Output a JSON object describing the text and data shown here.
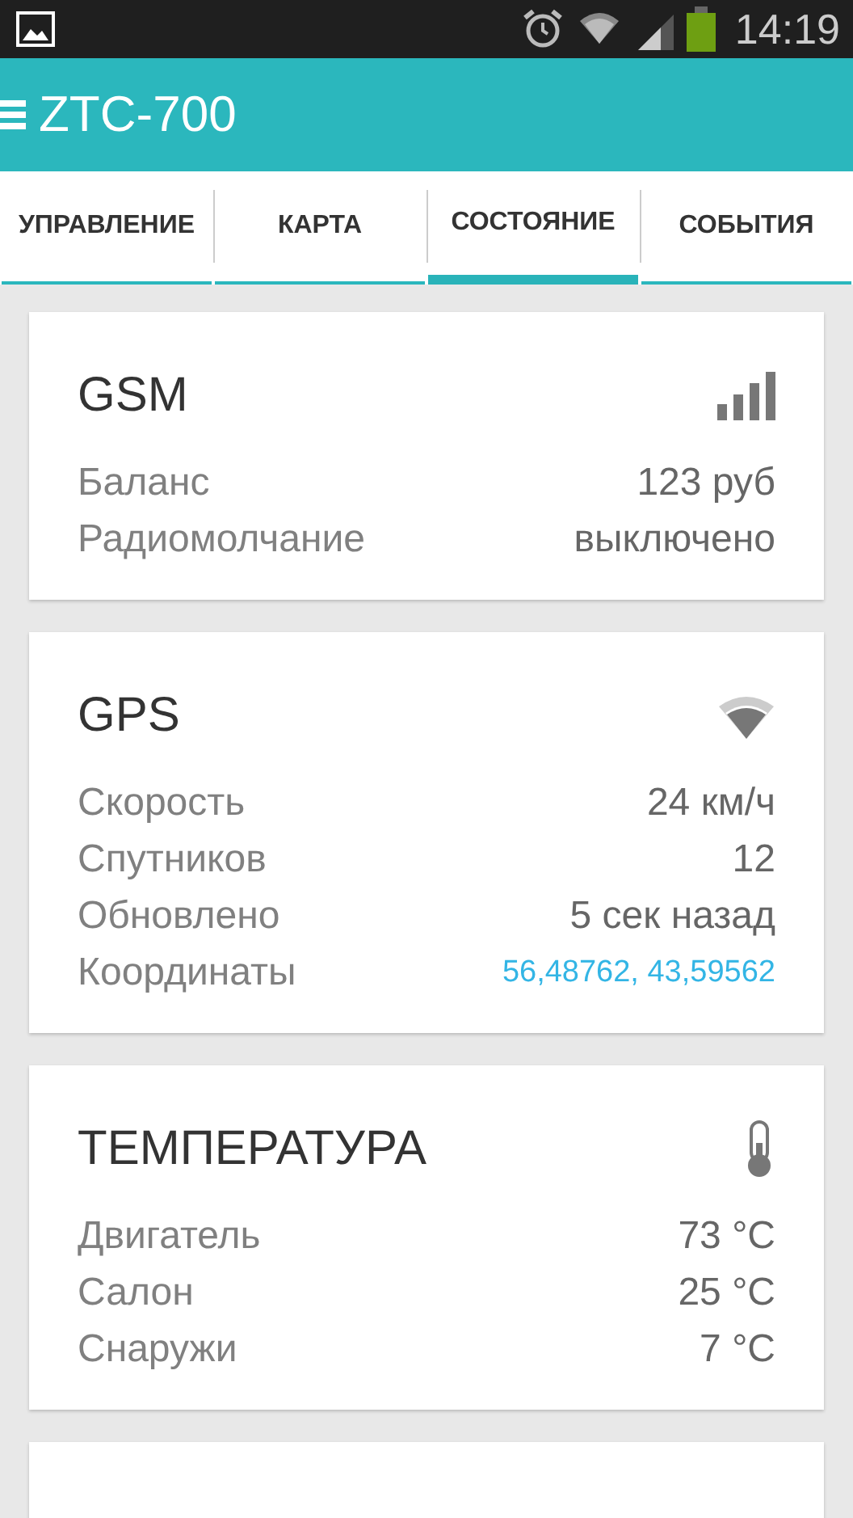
{
  "status_bar": {
    "time": "14:19"
  },
  "app_bar": {
    "title": "ZTC-700"
  },
  "tabs": [
    {
      "label": "УПРАВЛЕНИЕ",
      "selected": false
    },
    {
      "label": "КАРТА",
      "selected": false
    },
    {
      "label": "СОСТОЯНИЕ",
      "selected": true
    },
    {
      "label": "СОБЫТИЯ",
      "selected": false
    }
  ],
  "cards": [
    {
      "title": "GSM",
      "kind": "signal",
      "rows": [
        {
          "label": "Баланс",
          "value": "123 руб",
          "link": false
        },
        {
          "label": "Радиомолчание",
          "value": "выключено",
          "link": false
        }
      ]
    },
    {
      "title": "GPS",
      "kind": "gps",
      "rows": [
        {
          "label": "Скорость",
          "value": "24 км/ч",
          "link": false
        },
        {
          "label": "Спутников",
          "value": "12",
          "link": false
        },
        {
          "label": "Обновлено",
          "value": "5 сек назад",
          "link": false
        },
        {
          "label": "Координаты",
          "value": "56,48762, 43,59562",
          "link": true
        }
      ]
    },
    {
      "title": "ТЕМПЕРАТУРА",
      "kind": "temperature",
      "rows": [
        {
          "label": "Двигатель",
          "value": "73 °C",
          "link": false
        },
        {
          "label": "Салон",
          "value": "25 °C",
          "link": false
        },
        {
          "label": "Снаружи",
          "value": "7 °C",
          "link": false
        }
      ]
    },
    {
      "kind": "blank"
    }
  ]
}
